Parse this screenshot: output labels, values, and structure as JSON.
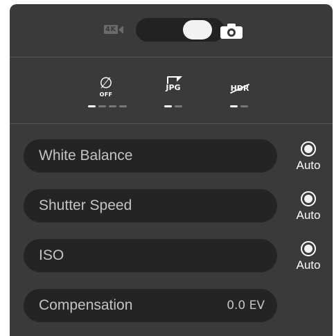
{
  "top": {
    "video_badge": "4K",
    "mode_toggle": "photo",
    "photo_icon": "camera-icon"
  },
  "modes": [
    {
      "icon": "timer-off-icon",
      "label": "OFF",
      "dots_total": 4,
      "dot_active": 1
    },
    {
      "icon": "jpg-file-icon",
      "label": "JPG",
      "dots_total": 2,
      "dot_active": 1
    },
    {
      "icon": "hdr-off-icon",
      "label": "HDR",
      "dots_total": 2,
      "dot_active": 1
    }
  ],
  "settings": {
    "white_balance": {
      "label": "White Balance",
      "auto_label": "Auto"
    },
    "shutter_speed": {
      "label": "Shutter Speed",
      "auto_label": "Auto"
    },
    "iso": {
      "label": "ISO",
      "auto_label": "Auto"
    },
    "compensation": {
      "label": "Compensation",
      "value": "0.0 EV"
    }
  }
}
